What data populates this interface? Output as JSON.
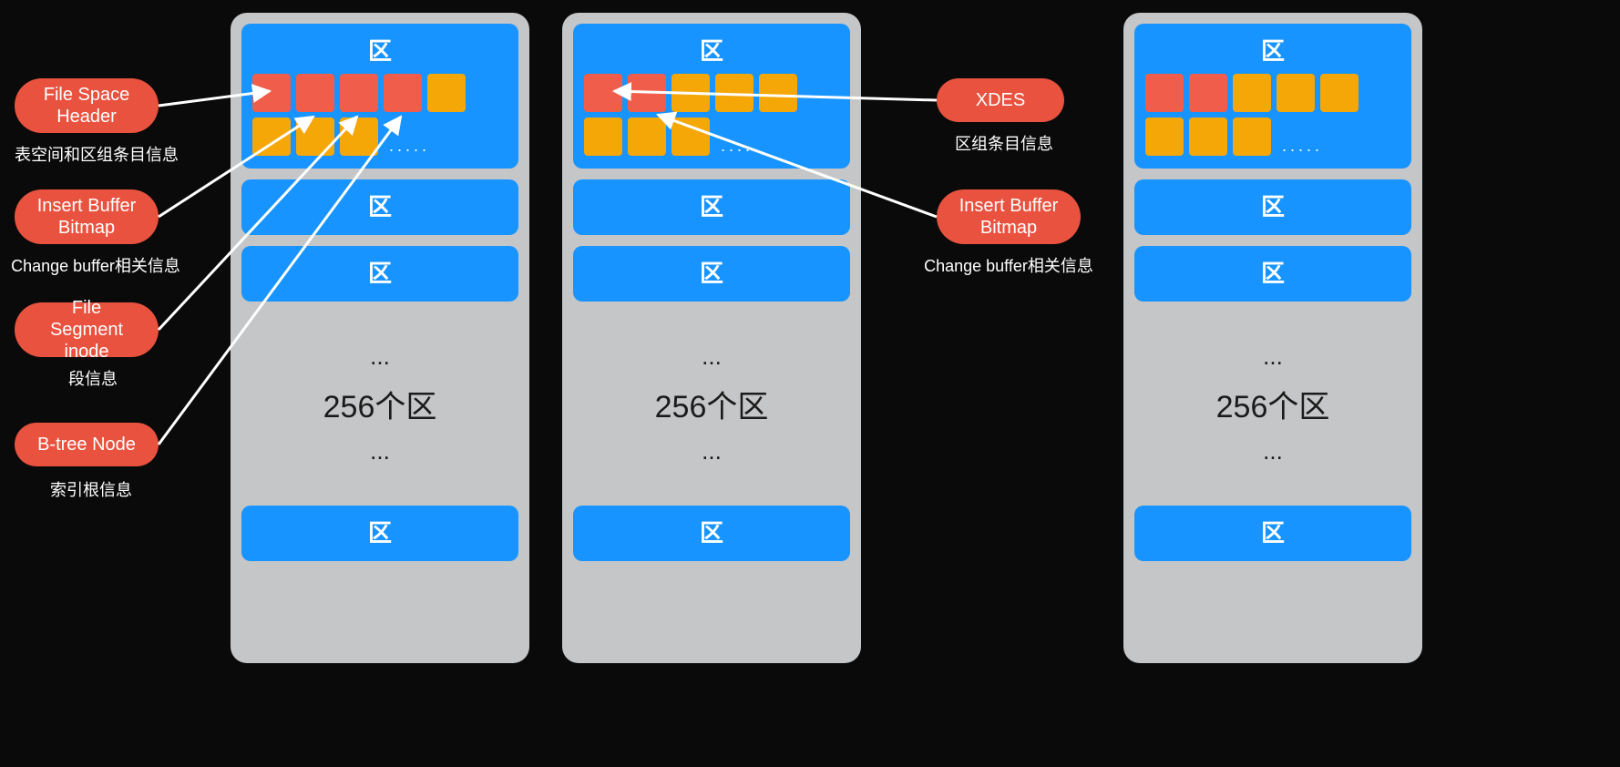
{
  "labels": {
    "fsh": {
      "text": "File Space\nHeader",
      "desc": "表空间和区组条目信息"
    },
    "ibb": {
      "text": "Insert Buffer\nBitmap",
      "desc": "Change buffer相关信息"
    },
    "fsi": {
      "text": "File Segment\ninode",
      "desc": "段信息"
    },
    "btn": {
      "text": "B-tree Node",
      "desc": "索引根信息"
    },
    "xdes": {
      "text": "XDES",
      "desc": "区组条目信息"
    },
    "ibb2": {
      "text": "Insert Buffer\nBitmap",
      "desc": "Change buffer相关信息"
    }
  },
  "zone_label": "区",
  "gap": {
    "dots": "...",
    "text": "256个区"
  },
  "ellipsis": ".....",
  "groups": [
    {
      "first_zone_cells": [
        "red",
        "red",
        "red",
        "red",
        "yel",
        "yel",
        "yel",
        "yel"
      ],
      "extra_zones": [
        "区",
        "区"
      ],
      "gap_then_last_zone": true
    },
    {
      "first_zone_cells": [
        "red",
        "red",
        "yel",
        "yel",
        "yel",
        "yel",
        "yel",
        "yel"
      ],
      "extra_zones": [
        "区",
        "区"
      ],
      "gap_then_last_zone": true
    },
    {
      "first_zone_cells": [
        "red",
        "red",
        "yel",
        "yel",
        "yel",
        "yel",
        "yel",
        "yel"
      ],
      "extra_zones": [
        "区",
        "区"
      ],
      "gap_then_last_zone": true
    }
  ]
}
